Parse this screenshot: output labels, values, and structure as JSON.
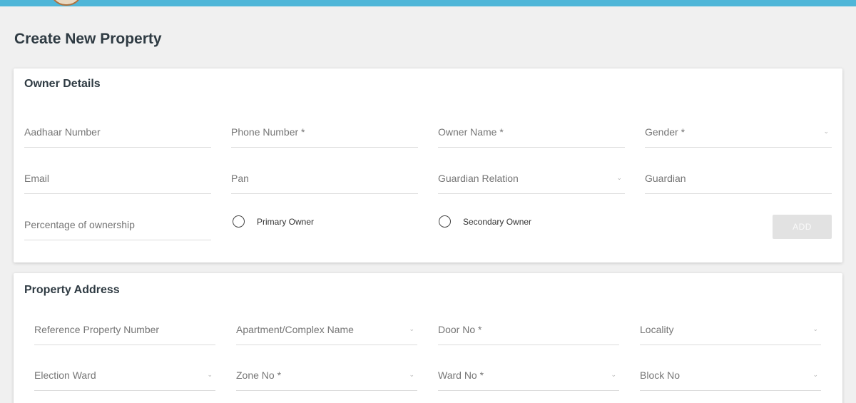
{
  "page": {
    "title": "Create New Property"
  },
  "owner_details": {
    "title": "Owner Details",
    "aadhaar_label": "Aadhaar Number",
    "phone_label": "Phone Number *",
    "owner_name_label": "Owner Name *",
    "gender_label": "Gender *",
    "email_label": "Email",
    "pan_label": "Pan",
    "guardian_relation_label": "Guardian Relation",
    "guardian_label": "Guardian",
    "percentage_label": "Percentage of ownership",
    "primary_owner_label": "Primary Owner",
    "secondary_owner_label": "Secondary Owner",
    "add_button_label": "ADD"
  },
  "property_address": {
    "title": "Property Address",
    "reference_label": "Reference Property Number",
    "apartment_label": "Apartment/Complex Name",
    "door_label": "Door No *",
    "locality_label": "Locality",
    "election_ward_label": "Election Ward",
    "zone_label": "Zone No *",
    "ward_label": "Ward No *",
    "block_label": "Block No"
  },
  "icons": {
    "dropdown_caret": "⌄"
  },
  "colors": {
    "topbar": "#4fb6d8",
    "page_background": "#f0f0f0",
    "card_background": "#ffffff",
    "title_text": "#2f3b43",
    "label_text": "#757575",
    "add_button_bg": "#e2e2e2"
  }
}
